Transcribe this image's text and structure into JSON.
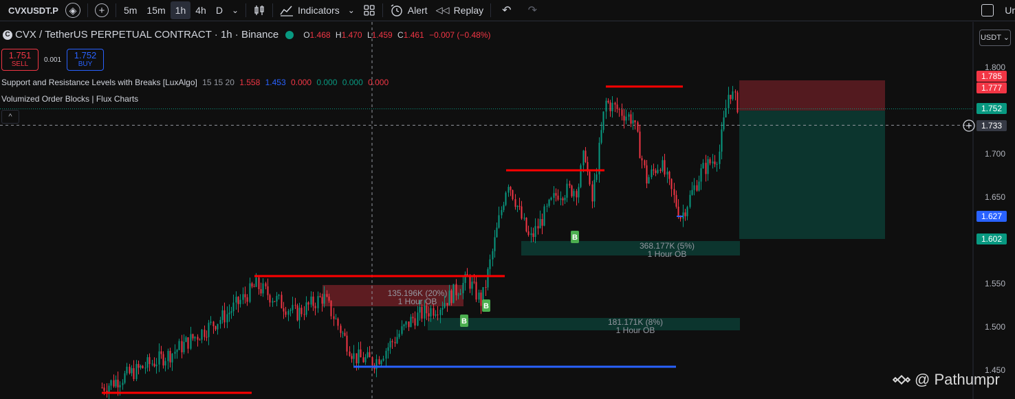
{
  "toolbar": {
    "symbol": "CVXUSDT.P",
    "timeframes": [
      "5m",
      "15m",
      "1h",
      "4h",
      "D"
    ],
    "active_timeframe": "1h",
    "indicators_label": "Indicators",
    "alert_label": "Alert",
    "replay_label": "Replay",
    "right_text": "Ur"
  },
  "legend": {
    "title": "CVX / TetherUS PERPETUAL CONTRACT · 1h · Binance",
    "o_label": "O",
    "o": "1.468",
    "h_label": "H",
    "h": "1.470",
    "l_label": "L",
    "l": "1.459",
    "c_label": "C",
    "c": "1.461",
    "change": "−0.007 (−0.48%)"
  },
  "trade": {
    "sell_price": "1.751",
    "sell_label": "SELL",
    "spread": "0.001",
    "buy_price": "1.752",
    "buy_label": "BUY"
  },
  "indicators": {
    "sr_name": "Support and Resistance Levels with Breaks [LuxAlgo]",
    "sr_params": "15 15 20",
    "sr_v1": "1.558",
    "sr_v2": "1.453",
    "sr_v3": "0.000",
    "sr_v4": "0.000",
    "sr_v5": "0.000",
    "sr_v6": "0.000",
    "ob_name": "Volumized Order Blocks | Flux Charts",
    "collapse_icon": "^"
  },
  "price_axis": {
    "currency_button": "USDT",
    "ticks": [
      "1.800",
      "1.750",
      "1.700",
      "1.650",
      "1.600",
      "1.550",
      "1.500",
      "1.450"
    ],
    "tick_values": [
      1.8,
      1.75,
      1.7,
      1.65,
      1.6,
      1.55,
      1.5,
      1.45
    ],
    "labels": [
      {
        "text": "1.785",
        "value": 1.785,
        "color": "#f23645"
      },
      {
        "text": "1.777",
        "value": 1.777,
        "color": "#f23645"
      },
      {
        "text": "1.752",
        "value": 1.752,
        "color": "#089981"
      },
      {
        "text": "1.733",
        "value": 1.733,
        "color": "#363a45"
      },
      {
        "text": "1.627",
        "value": 1.627,
        "color": "#2962ff"
      },
      {
        "text": "1.602",
        "value": 1.602,
        "color": "#089981"
      }
    ]
  },
  "order_blocks": [
    {
      "volume": "368.177K (5%)",
      "label": "1 Hour OB"
    },
    {
      "volume": "135.196K (20%)",
      "label": "1 Hour OB"
    },
    {
      "volume": "181.171K (8%)",
      "label": "1 Hour OB"
    }
  ],
  "markers": [
    "B",
    "B",
    "B",
    "B"
  ],
  "watermark": "@ Pathumpr",
  "colors": {
    "up": "#089981",
    "down": "#f23645",
    "resistance": "#ff0000",
    "support": "#2962ff",
    "background": "#0f0f0f"
  },
  "chart_data": {
    "type": "candlestick",
    "series_start": 1.47,
    "ylim": [
      1.44,
      1.815
    ],
    "current_price": 1.752,
    "crosshair_price": 1.733,
    "resistance_levels": [
      1.775,
      1.68,
      1.558,
      1.48
    ],
    "support_levels": [
      1.453,
      1.627
    ]
  }
}
